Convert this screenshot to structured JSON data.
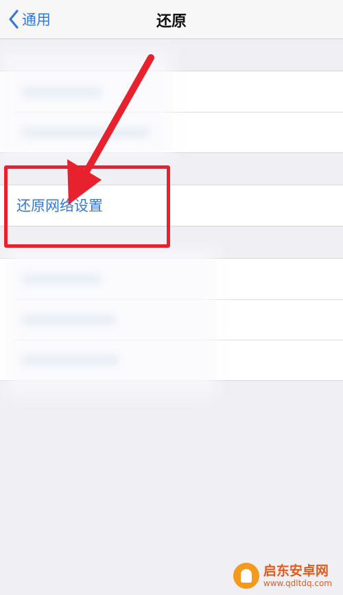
{
  "navbar": {
    "back_label": "通用",
    "title": "还原"
  },
  "reset_network": {
    "label": "还原网络设置"
  },
  "watermark": {
    "name": "启东安卓网",
    "url": "www.qdltdq.com"
  },
  "colors": {
    "accent": "#3478d6",
    "annotation": "#e8212e",
    "background": "#efeff4",
    "watermark": "#e25a1c"
  }
}
